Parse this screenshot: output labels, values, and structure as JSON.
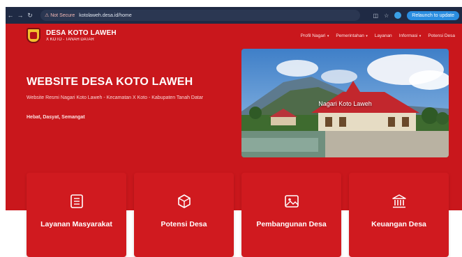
{
  "browser": {
    "back_icon": "arrow-left-icon",
    "forward_icon": "arrow-right-icon",
    "reload_icon": "reload-icon",
    "security_label": "Not Secure",
    "url": "kotolaweh.desa.id/home",
    "relaunch_label": "Relaunch to update"
  },
  "header": {
    "title": "DESA KOTO LAWEH",
    "subtitle": "X KOTO - TANAH DATAR",
    "menu": [
      {
        "label": "Profil Nagari",
        "dropdown": true
      },
      {
        "label": "Pemerintahan",
        "dropdown": true
      },
      {
        "label": "Layanan",
        "dropdown": false
      },
      {
        "label": "Informasi",
        "dropdown": true
      },
      {
        "label": "Potensi Desa",
        "dropdown": false
      }
    ]
  },
  "hero": {
    "title": "WEBSITE DESA KOTO LAWEH",
    "description": "Website Resmi Nagari Koto Laweh - Kecamatan X Koto - Kabupaten Tanah Datar",
    "tagline": "Hebat, Dasyat, Semangat",
    "image_caption": "Nagari Koto Laweh"
  },
  "cards": [
    {
      "label": "Layanan Masyarakat",
      "icon": "document-list-icon"
    },
    {
      "label": "Potensi Desa",
      "icon": "cube-icon"
    },
    {
      "label": "Pembangunan Desa",
      "icon": "image-icon"
    },
    {
      "label": "Keuangan Desa",
      "icon": "bank-icon"
    }
  ],
  "colors": {
    "brand_red": "#c9171c",
    "card_red": "#d01a1f",
    "chrome": "#1f2a44",
    "relaunch_blue": "#2a8de0"
  }
}
